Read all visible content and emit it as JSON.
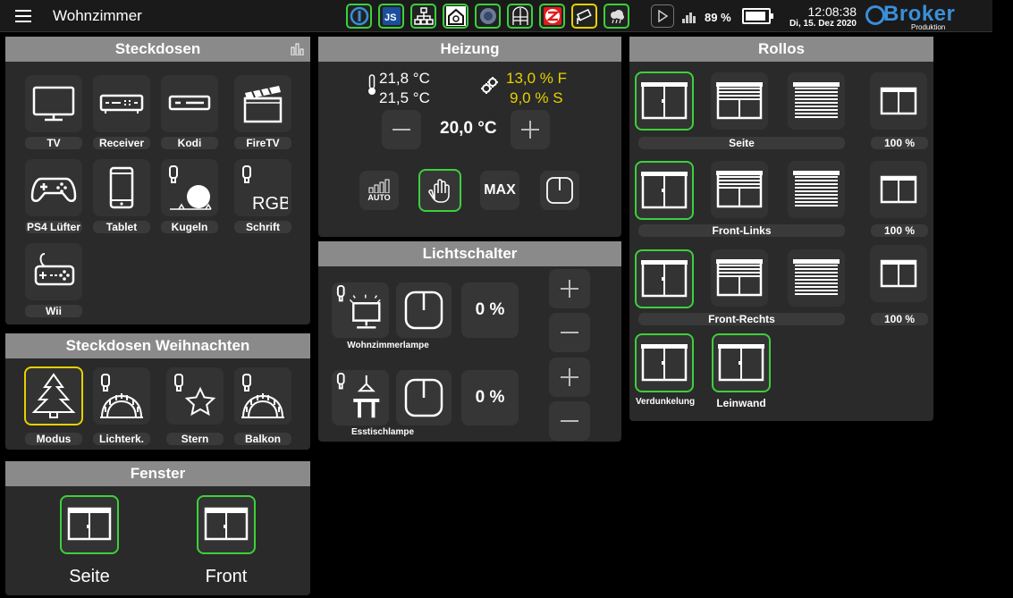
{
  "header": {
    "room": "Wohnzimmer",
    "battery": "89 %",
    "time": "12:08:38",
    "date": "Di, 15. Dez 2020",
    "logo": "Broker",
    "logo_sub": "Produktion",
    "adapters": [
      "info-icon",
      "javascript-icon",
      "network-icon",
      "homematic-icon",
      "sonos-icon",
      "window-icon",
      "zigbee-icon",
      "camera-icon",
      "weather-icon"
    ]
  },
  "steckdosen": {
    "title": "Steckdosen",
    "items": [
      {
        "label": "TV",
        "icon": "tv-icon"
      },
      {
        "label": "Receiver",
        "icon": "receiver-icon"
      },
      {
        "label": "Kodi",
        "icon": "kodi-box-icon"
      },
      {
        "label": "FireTV",
        "icon": "clapperboard-icon"
      },
      {
        "label": "PS4 Lüfter",
        "icon": "gamepad-icon"
      },
      {
        "label": "Tablet",
        "icon": "tablet-icon"
      },
      {
        "label": "Kugeln",
        "icon": "ball-light-icon"
      },
      {
        "label": "Schrift",
        "icon": "rgb-text-icon"
      },
      {
        "label": "Wii",
        "icon": "wii-controller-icon"
      }
    ]
  },
  "weihnachten": {
    "title": "Steckdosen Weihnachten",
    "items": [
      {
        "label": "Modus",
        "icon": "christmas-tree-icon"
      },
      {
        "label": "Lichterk.",
        "icon": "candle-arch-icon"
      },
      {
        "label": "Stern",
        "icon": "star-icon"
      },
      {
        "label": "Balkon",
        "icon": "candle-arch-icon"
      }
    ]
  },
  "fenster": {
    "title": "Fenster",
    "items": [
      {
        "label": "Seite"
      },
      {
        "label": "Front"
      }
    ]
  },
  "heizung": {
    "title": "Heizung",
    "temp_actual": "21,8 °C",
    "temp_second": "21,5 °C",
    "valve_f": "13,0 % F",
    "valve_s": "9,0 % S",
    "setpoint": "20,0 °C",
    "auto_label": "AUTO",
    "max_label": "MAX"
  },
  "lichtschalter": {
    "title": "Lichtschalter",
    "items": [
      {
        "label": "Wohnzimmerlampe",
        "value": "0 %"
      },
      {
        "label": "Esstischlampe",
        "value": "0 %"
      }
    ]
  },
  "rollos": {
    "title": "Rollos",
    "rows": [
      {
        "label": "Seite",
        "percent": "100 %"
      },
      {
        "label": "Front-Links",
        "percent": "100 %"
      },
      {
        "label": "Front-Rechts",
        "percent": "100 %"
      }
    ],
    "extra": [
      {
        "label": "Verdunkelung"
      },
      {
        "label": "Leinwand"
      }
    ]
  },
  "colors": {
    "active_border": "#3bd13b",
    "yellow": "#e6d100",
    "header_bg": "#8a8a8a",
    "panel_bg": "#2a2a2a",
    "logo_blue": "#3a8fd9"
  }
}
